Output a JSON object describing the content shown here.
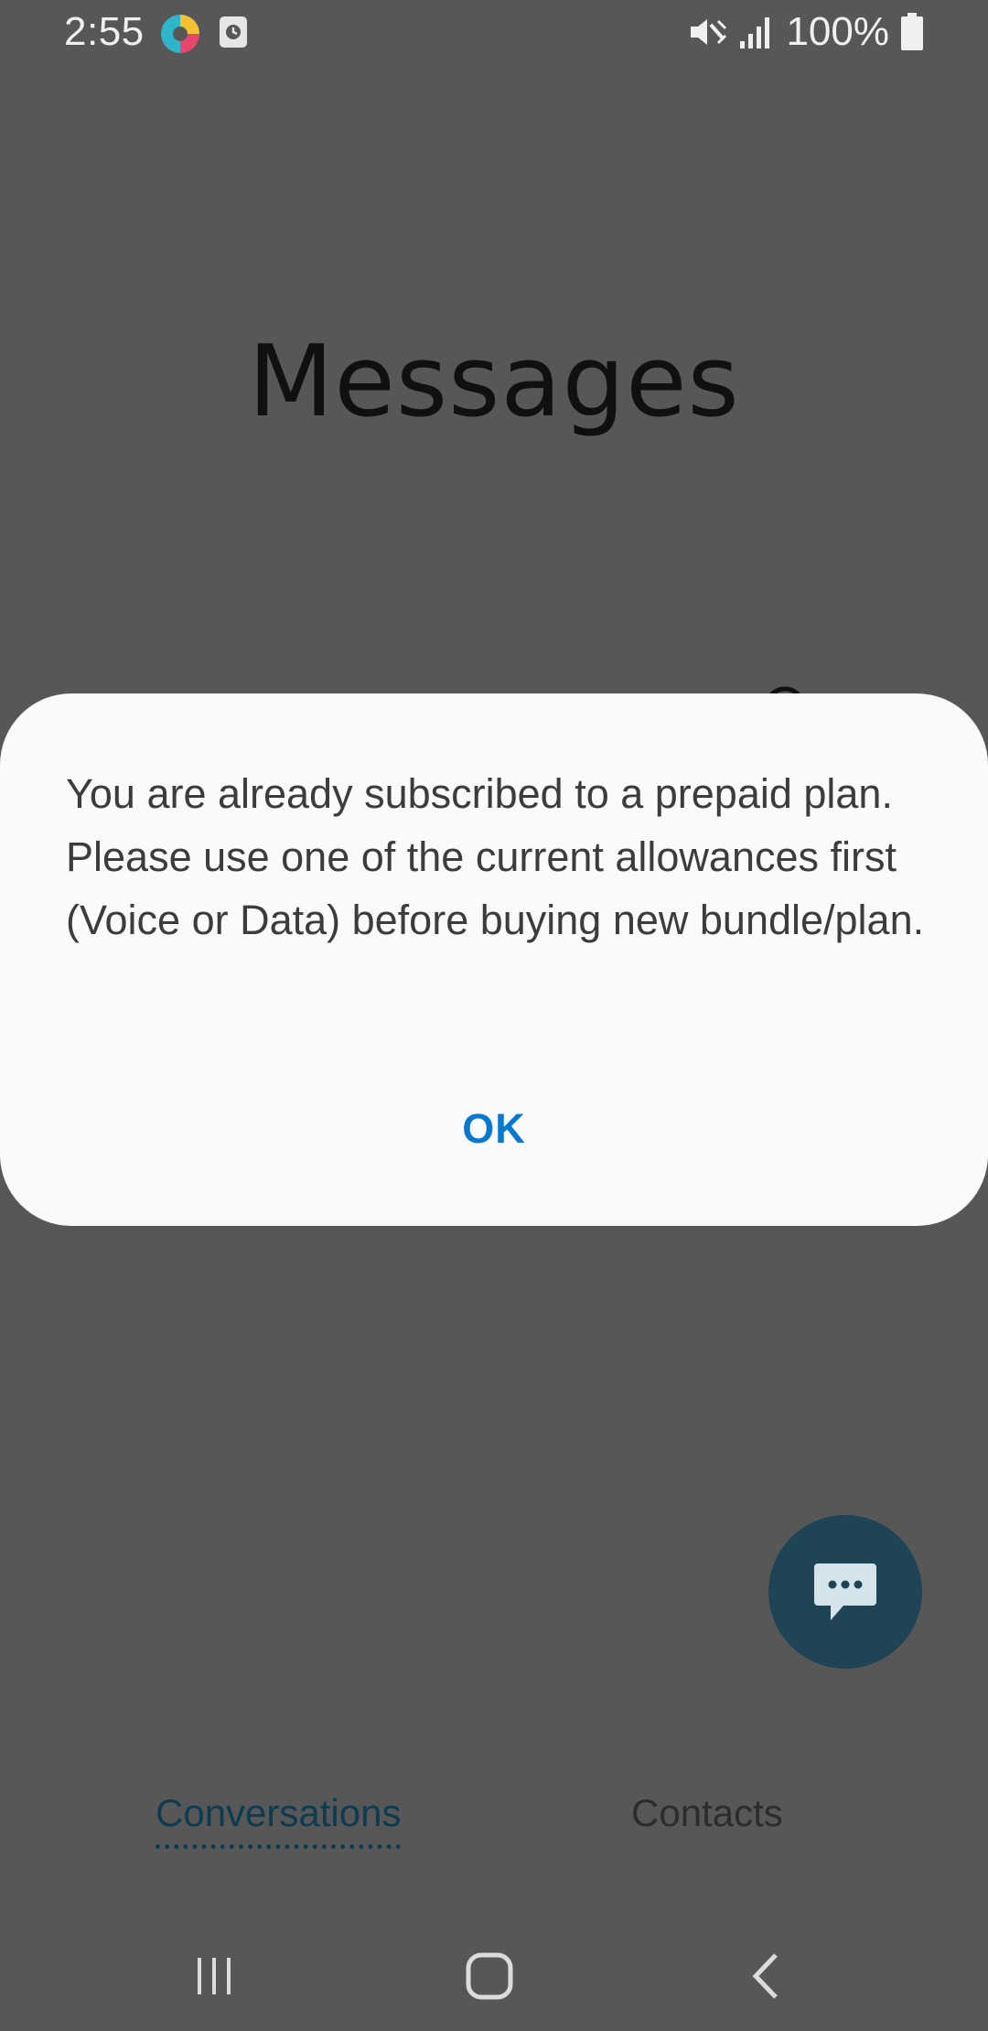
{
  "status_bar": {
    "time": "2:55",
    "battery": "100%",
    "icons": [
      "app-notification-icon",
      "screen-recorder-icon",
      "vibrate-icon",
      "signal-icon",
      "battery-icon"
    ]
  },
  "header": {
    "title": "Messages"
  },
  "dialog": {
    "message": "You are already subscribed to a prepaid plan. Please use one of the current allowances first (Voice or Data) before buying new bundle/plan.",
    "ok_label": "OK"
  },
  "tabs": [
    {
      "label": "Conversations",
      "selected": true
    },
    {
      "label": "Contacts",
      "selected": false
    }
  ],
  "fab": {
    "icon": "compose-message-icon"
  },
  "colors": {
    "scrim_background": "#575757",
    "dialog_background": "#fafafa",
    "accent": "#0a78cf",
    "fab": "#1e4456",
    "selected_tab": "#0d3b50"
  }
}
